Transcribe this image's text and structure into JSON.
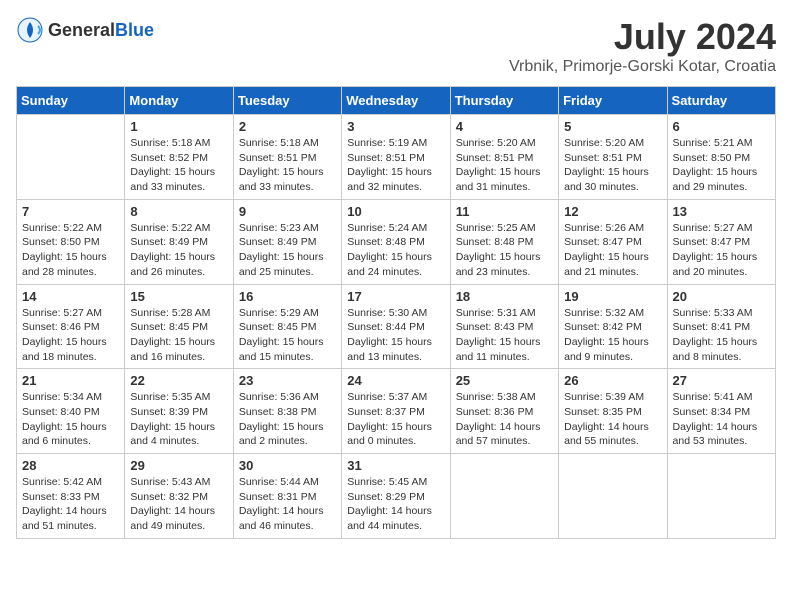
{
  "logo": {
    "general": "General",
    "blue": "Blue"
  },
  "title": {
    "month": "July 2024",
    "location": "Vrbnik, Primorje-Gorski Kotar, Croatia"
  },
  "weekdays": [
    "Sunday",
    "Monday",
    "Tuesday",
    "Wednesday",
    "Thursday",
    "Friday",
    "Saturday"
  ],
  "weeks": [
    [
      {
        "day": "",
        "sunrise": "",
        "sunset": "",
        "daylight": ""
      },
      {
        "day": "1",
        "sunrise": "Sunrise: 5:18 AM",
        "sunset": "Sunset: 8:52 PM",
        "daylight": "Daylight: 15 hours and 33 minutes."
      },
      {
        "day": "2",
        "sunrise": "Sunrise: 5:18 AM",
        "sunset": "Sunset: 8:51 PM",
        "daylight": "Daylight: 15 hours and 33 minutes."
      },
      {
        "day": "3",
        "sunrise": "Sunrise: 5:19 AM",
        "sunset": "Sunset: 8:51 PM",
        "daylight": "Daylight: 15 hours and 32 minutes."
      },
      {
        "day": "4",
        "sunrise": "Sunrise: 5:20 AM",
        "sunset": "Sunset: 8:51 PM",
        "daylight": "Daylight: 15 hours and 31 minutes."
      },
      {
        "day": "5",
        "sunrise": "Sunrise: 5:20 AM",
        "sunset": "Sunset: 8:51 PM",
        "daylight": "Daylight: 15 hours and 30 minutes."
      },
      {
        "day": "6",
        "sunrise": "Sunrise: 5:21 AM",
        "sunset": "Sunset: 8:50 PM",
        "daylight": "Daylight: 15 hours and 29 minutes."
      }
    ],
    [
      {
        "day": "7",
        "sunrise": "Sunrise: 5:22 AM",
        "sunset": "Sunset: 8:50 PM",
        "daylight": "Daylight: 15 hours and 28 minutes."
      },
      {
        "day": "8",
        "sunrise": "Sunrise: 5:22 AM",
        "sunset": "Sunset: 8:49 PM",
        "daylight": "Daylight: 15 hours and 26 minutes."
      },
      {
        "day": "9",
        "sunrise": "Sunrise: 5:23 AM",
        "sunset": "Sunset: 8:49 PM",
        "daylight": "Daylight: 15 hours and 25 minutes."
      },
      {
        "day": "10",
        "sunrise": "Sunrise: 5:24 AM",
        "sunset": "Sunset: 8:48 PM",
        "daylight": "Daylight: 15 hours and 24 minutes."
      },
      {
        "day": "11",
        "sunrise": "Sunrise: 5:25 AM",
        "sunset": "Sunset: 8:48 PM",
        "daylight": "Daylight: 15 hours and 23 minutes."
      },
      {
        "day": "12",
        "sunrise": "Sunrise: 5:26 AM",
        "sunset": "Sunset: 8:47 PM",
        "daylight": "Daylight: 15 hours and 21 minutes."
      },
      {
        "day": "13",
        "sunrise": "Sunrise: 5:27 AM",
        "sunset": "Sunset: 8:47 PM",
        "daylight": "Daylight: 15 hours and 20 minutes."
      }
    ],
    [
      {
        "day": "14",
        "sunrise": "Sunrise: 5:27 AM",
        "sunset": "Sunset: 8:46 PM",
        "daylight": "Daylight: 15 hours and 18 minutes."
      },
      {
        "day": "15",
        "sunrise": "Sunrise: 5:28 AM",
        "sunset": "Sunset: 8:45 PM",
        "daylight": "Daylight: 15 hours and 16 minutes."
      },
      {
        "day": "16",
        "sunrise": "Sunrise: 5:29 AM",
        "sunset": "Sunset: 8:45 PM",
        "daylight": "Daylight: 15 hours and 15 minutes."
      },
      {
        "day": "17",
        "sunrise": "Sunrise: 5:30 AM",
        "sunset": "Sunset: 8:44 PM",
        "daylight": "Daylight: 15 hours and 13 minutes."
      },
      {
        "day": "18",
        "sunrise": "Sunrise: 5:31 AM",
        "sunset": "Sunset: 8:43 PM",
        "daylight": "Daylight: 15 hours and 11 minutes."
      },
      {
        "day": "19",
        "sunrise": "Sunrise: 5:32 AM",
        "sunset": "Sunset: 8:42 PM",
        "daylight": "Daylight: 15 hours and 9 minutes."
      },
      {
        "day": "20",
        "sunrise": "Sunrise: 5:33 AM",
        "sunset": "Sunset: 8:41 PM",
        "daylight": "Daylight: 15 hours and 8 minutes."
      }
    ],
    [
      {
        "day": "21",
        "sunrise": "Sunrise: 5:34 AM",
        "sunset": "Sunset: 8:40 PM",
        "daylight": "Daylight: 15 hours and 6 minutes."
      },
      {
        "day": "22",
        "sunrise": "Sunrise: 5:35 AM",
        "sunset": "Sunset: 8:39 PM",
        "daylight": "Daylight: 15 hours and 4 minutes."
      },
      {
        "day": "23",
        "sunrise": "Sunrise: 5:36 AM",
        "sunset": "Sunset: 8:38 PM",
        "daylight": "Daylight: 15 hours and 2 minutes."
      },
      {
        "day": "24",
        "sunrise": "Sunrise: 5:37 AM",
        "sunset": "Sunset: 8:37 PM",
        "daylight": "Daylight: 15 hours and 0 minutes."
      },
      {
        "day": "25",
        "sunrise": "Sunrise: 5:38 AM",
        "sunset": "Sunset: 8:36 PM",
        "daylight": "Daylight: 14 hours and 57 minutes."
      },
      {
        "day": "26",
        "sunrise": "Sunrise: 5:39 AM",
        "sunset": "Sunset: 8:35 PM",
        "daylight": "Daylight: 14 hours and 55 minutes."
      },
      {
        "day": "27",
        "sunrise": "Sunrise: 5:41 AM",
        "sunset": "Sunset: 8:34 PM",
        "daylight": "Daylight: 14 hours and 53 minutes."
      }
    ],
    [
      {
        "day": "28",
        "sunrise": "Sunrise: 5:42 AM",
        "sunset": "Sunset: 8:33 PM",
        "daylight": "Daylight: 14 hours and 51 minutes."
      },
      {
        "day": "29",
        "sunrise": "Sunrise: 5:43 AM",
        "sunset": "Sunset: 8:32 PM",
        "daylight": "Daylight: 14 hours and 49 minutes."
      },
      {
        "day": "30",
        "sunrise": "Sunrise: 5:44 AM",
        "sunset": "Sunset: 8:31 PM",
        "daylight": "Daylight: 14 hours and 46 minutes."
      },
      {
        "day": "31",
        "sunrise": "Sunrise: 5:45 AM",
        "sunset": "Sunset: 8:29 PM",
        "daylight": "Daylight: 14 hours and 44 minutes."
      },
      {
        "day": "",
        "sunrise": "",
        "sunset": "",
        "daylight": ""
      },
      {
        "day": "",
        "sunrise": "",
        "sunset": "",
        "daylight": ""
      },
      {
        "day": "",
        "sunrise": "",
        "sunset": "",
        "daylight": ""
      }
    ]
  ]
}
